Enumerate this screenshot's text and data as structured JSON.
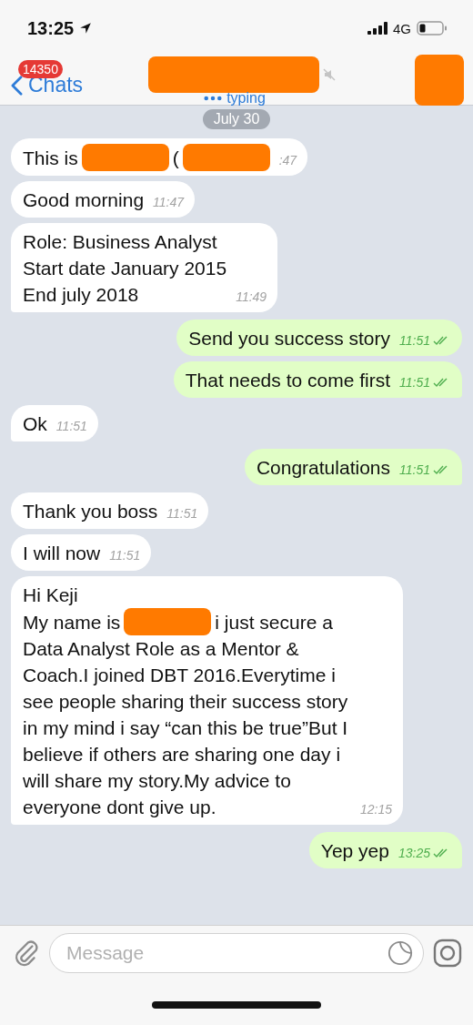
{
  "status_bar": {
    "time": "13:25",
    "network": "4G"
  },
  "header": {
    "badge": "14350",
    "back_label": "Chats",
    "title": {
      "kind": "redacted"
    },
    "muted": true,
    "status": "typing",
    "avatar": {
      "kind": "redacted"
    }
  },
  "date_label": "July 30",
  "messages": [
    {
      "outgoing": false,
      "tail": false,
      "lines": [
        [
          {
            "kind": "text",
            "text": "This is"
          },
          {
            "kind": "redacted"
          },
          {
            "kind": "text",
            "text": "("
          },
          {
            "kind": "redacted"
          }
        ]
      ],
      "time": ":47"
    },
    {
      "outgoing": false,
      "tail": false,
      "lines": [
        [
          {
            "kind": "text",
            "text": "Good morning"
          }
        ]
      ],
      "time": "11:47"
    },
    {
      "outgoing": false,
      "tail": true,
      "lines": [
        [
          {
            "kind": "text",
            "text": "Role: Business Analyst\nStart date January 2015\nEnd july 2018"
          }
        ]
      ],
      "time": "11:49"
    },
    {
      "outgoing": true,
      "tail": false,
      "read": true,
      "lines": [
        [
          {
            "kind": "text",
            "text": "Send you success story"
          }
        ]
      ],
      "time": "11:51"
    },
    {
      "outgoing": true,
      "tail": true,
      "read": true,
      "lines": [
        [
          {
            "kind": "text",
            "text": "That needs to come first"
          }
        ]
      ],
      "time": "11:51"
    },
    {
      "outgoing": false,
      "tail": true,
      "lines": [
        [
          {
            "kind": "text",
            "text": "Ok"
          }
        ]
      ],
      "time": "11:51"
    },
    {
      "outgoing": true,
      "tail": true,
      "read": true,
      "lines": [
        [
          {
            "kind": "text",
            "text": "Congratulations"
          }
        ]
      ],
      "time": "11:51"
    },
    {
      "outgoing": false,
      "tail": false,
      "lines": [
        [
          {
            "kind": "text",
            "text": "Thank you boss"
          }
        ]
      ],
      "time": "11:51"
    },
    {
      "outgoing": false,
      "tail": false,
      "lines": [
        [
          {
            "kind": "text",
            "text": "I will now"
          }
        ]
      ],
      "time": "11:51"
    },
    {
      "outgoing": false,
      "tail": true,
      "lines": [
        [
          {
            "kind": "text",
            "text": "Hi Keji"
          }
        ],
        [
          {
            "kind": "text",
            "text": "My name is"
          },
          {
            "kind": "redacted"
          },
          {
            "kind": "text",
            "text": "i just secure a"
          }
        ],
        [
          {
            "kind": "text",
            "text": "Data Analyst Role as a Mentor & Coach.I joined DBT 2016.Everytime i see people sharing their success story in my mind i say “can this be true”But I believe if others are sharing one day i will share my story.My advice to everyone dont give up."
          }
        ]
      ],
      "time": "12:15"
    },
    {
      "outgoing": true,
      "tail": true,
      "read": true,
      "lines": [
        [
          {
            "kind": "text",
            "text": "Yep yep"
          }
        ]
      ],
      "time": "13:25"
    }
  ],
  "composer": {
    "placeholder": "Message"
  }
}
